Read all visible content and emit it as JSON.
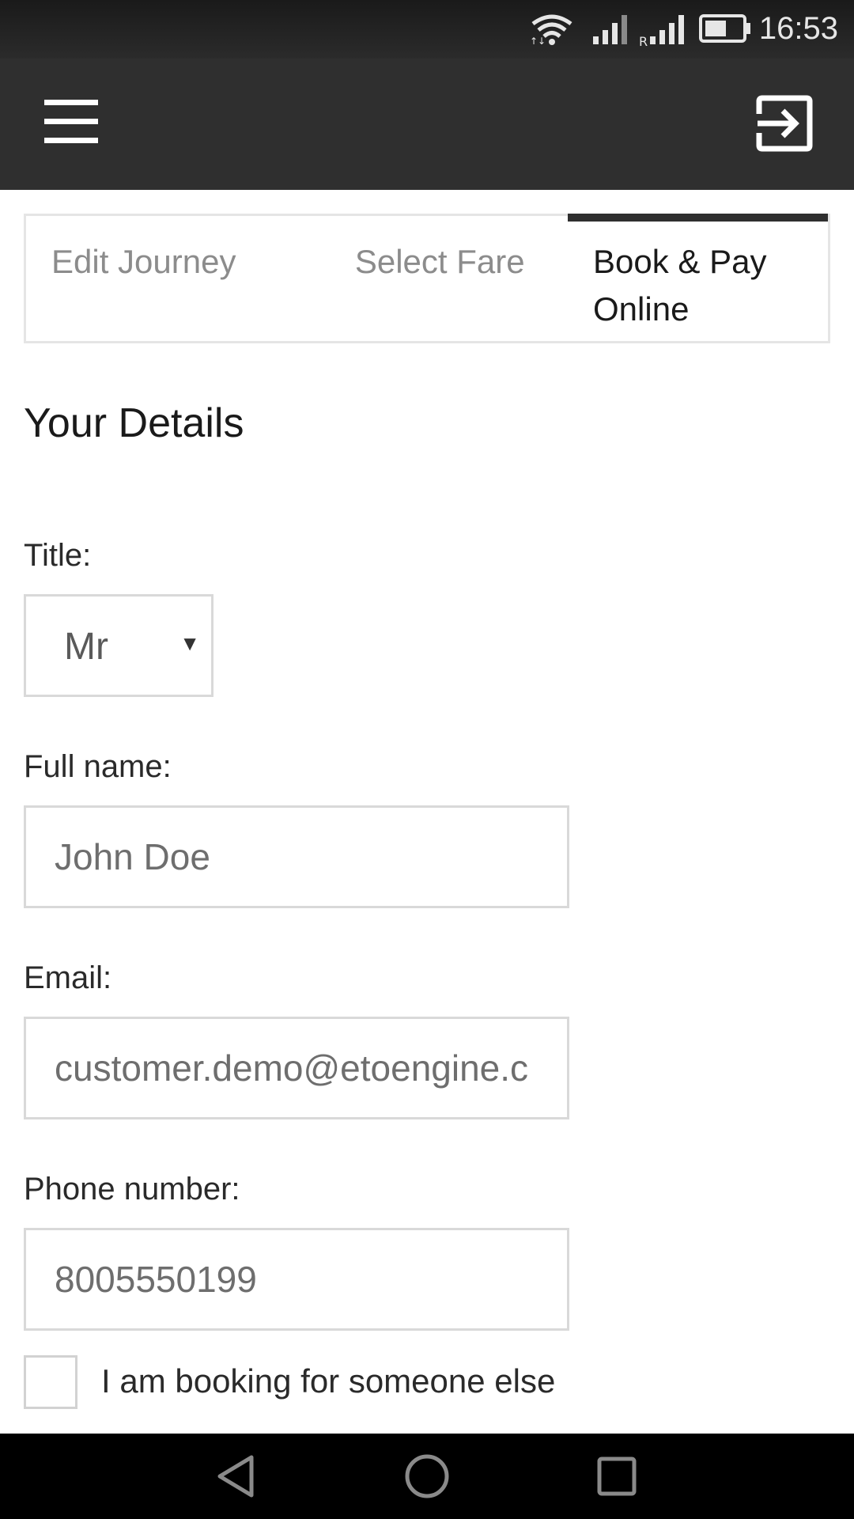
{
  "status_bar": {
    "time": "16:53",
    "icons": [
      "wifi-icon",
      "signal-icon",
      "roaming-signal-icon",
      "battery-icon"
    ]
  },
  "app_bar": {
    "menu_icon": "hamburger-menu-icon",
    "logout_icon": "exit-icon"
  },
  "tabs": [
    {
      "label": "Edit Journey",
      "active": false
    },
    {
      "label": "Select Fare",
      "active": false
    },
    {
      "label": "Book & Pay Online",
      "active": true
    }
  ],
  "section_title": "Your Details",
  "form": {
    "title_label": "Title:",
    "title_value": "Mr",
    "name_label": "Full name:",
    "name_placeholder": "John Doe",
    "email_label": "Email:",
    "email_placeholder": "customer.demo@etoengine.c",
    "phone_label": "Phone number:",
    "phone_placeholder": "8005550199",
    "someone_else_label": "I am booking for someone else"
  },
  "nav_bar": {
    "icons": [
      "back-icon",
      "home-icon",
      "recents-icon"
    ]
  },
  "colors": {
    "app_bar": "#2f2f2f",
    "status_bar": "#1a1a1a",
    "active_tab_indicator": "#2f2f2f",
    "input_border": "#d9d9d9"
  }
}
